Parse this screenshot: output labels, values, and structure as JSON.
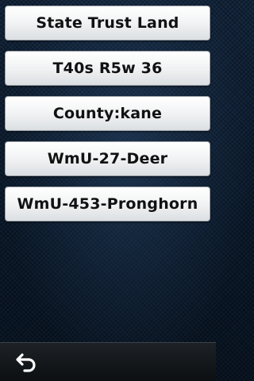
{
  "menu": {
    "items": [
      {
        "label": "State Trust Land"
      },
      {
        "label": "T40s R5w 36"
      },
      {
        "label": "County:kane"
      },
      {
        "label": "WmU-27-Deer"
      },
      {
        "label": "WmU-453-Pronghorn"
      }
    ]
  },
  "bottom_bar": {
    "back_icon": "back-arrow-icon"
  },
  "colors": {
    "background": "#0c1a2b",
    "button_face": "#f3f4f5",
    "button_text": "#111111",
    "bottom_bar": "#14181b",
    "icon": "#ffffff"
  }
}
